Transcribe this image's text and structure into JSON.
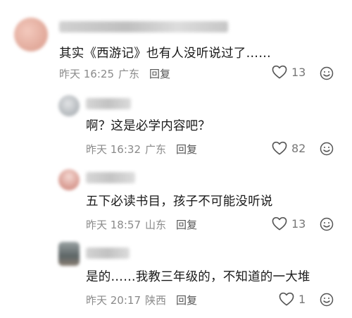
{
  "comments": [
    {
      "text": "其实《西游记》也有人没听说过了……",
      "time": "昨天 16:25",
      "location": "广东",
      "reply_label": "回复",
      "likes": "13",
      "avatar_color": "#e8b6a8"
    },
    {
      "text": "啊？这是必学内容吧？",
      "time": "昨天 16:32",
      "location": "广东",
      "reply_label": "回复",
      "likes": "82",
      "avatar_color": "#bfc3c7"
    },
    {
      "text": "五下必读书目，孩子不可能没听说",
      "time": "昨天 18:57",
      "location": "山东",
      "reply_label": "回复",
      "likes": "13",
      "avatar_color": "#d9a39a"
    },
    {
      "text": "是的……我教三年级的，不知道的一大堆",
      "time": "昨天 20:17",
      "location": "陕西",
      "reply_label": "回复",
      "likes": "1",
      "avatar_color": "#7f8a8c"
    }
  ],
  "icons": {
    "like": "heart-outline-icon",
    "emoji": "smiley-icon"
  }
}
